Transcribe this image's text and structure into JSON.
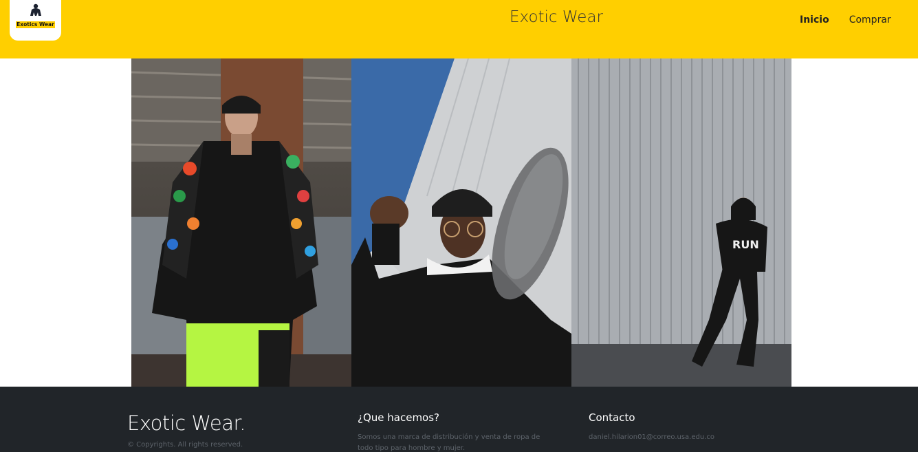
{
  "header": {
    "logo_text": "Exotics Wear",
    "title": "Exotic Wear",
    "nav": [
      {
        "label": "Inicio",
        "active": true
      },
      {
        "label": "Comprar",
        "active": false
      }
    ]
  },
  "gallery": {
    "images": [
      {
        "icon": "man-puffer-jacket-photo"
      },
      {
        "icon": "man-sneaker-photo"
      },
      {
        "icon": "woman-run-hoodie-photo"
      }
    ]
  },
  "footer": {
    "brand": "Exotic Wear.",
    "copyright": "© Copyrights. All rights reserved.",
    "about_heading": "¿Que hacemos?",
    "about_text_line1": "Somos una marca de distribución y venta de ropa de",
    "about_text_line2": "todo tipo para hombre y mujer.",
    "contact_heading": "Contacto",
    "contact_email": "daniel.hilarion01@correo.usa.edu.co"
  },
  "colors": {
    "header_bg": "#ffcf00",
    "footer_bg": "#212529",
    "muted_text": "#5d636a"
  }
}
